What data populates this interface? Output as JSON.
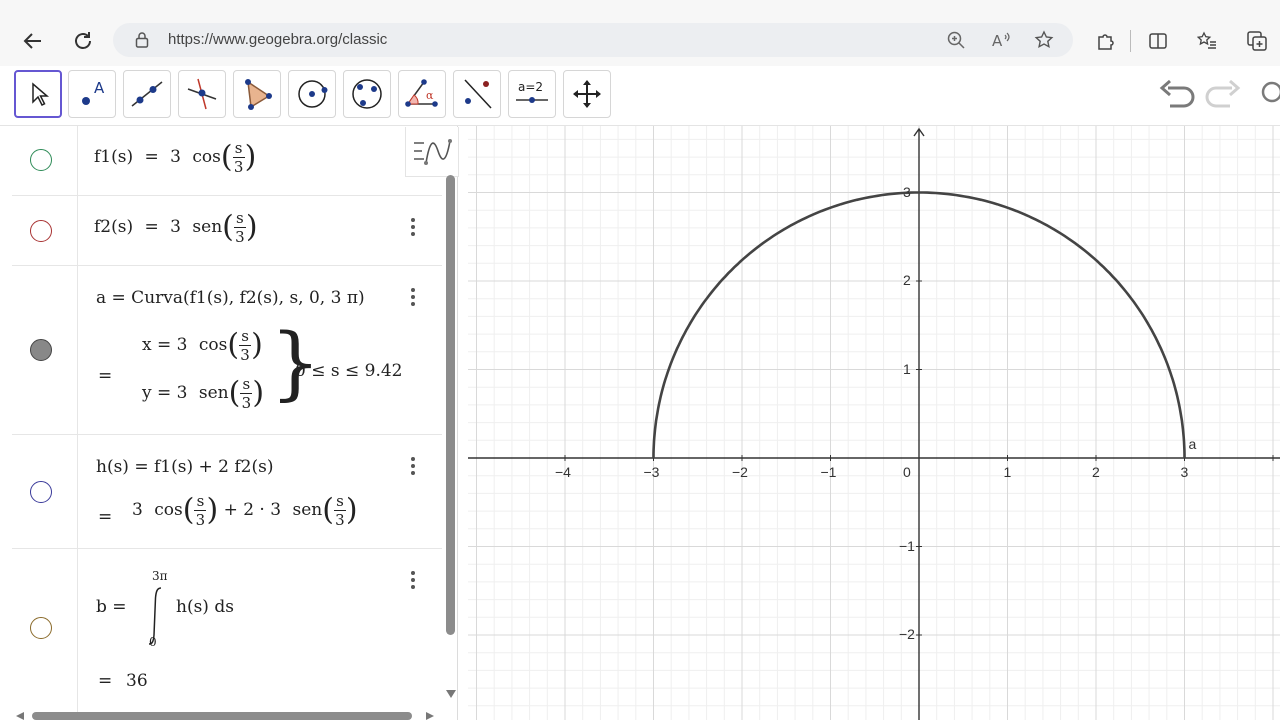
{
  "browser": {
    "url": "https://www.geogebra.org/classic"
  },
  "toolbar": {
    "tools": [
      {
        "id": "move",
        "icon": "arrow-pointer-icon"
      },
      {
        "id": "point",
        "icon": "point-icon",
        "label": "A"
      },
      {
        "id": "line",
        "icon": "line-icon"
      },
      {
        "id": "perpendicular",
        "icon": "perpendicular-line-icon"
      },
      {
        "id": "polygon",
        "icon": "polygon-icon"
      },
      {
        "id": "circle",
        "icon": "circle-center-point-icon"
      },
      {
        "id": "circle3",
        "icon": "circle-three-points-icon"
      },
      {
        "id": "angle",
        "icon": "angle-icon",
        "label": "α"
      },
      {
        "id": "reflect",
        "icon": "reflect-line-icon"
      },
      {
        "id": "slider",
        "icon": "slider-icon",
        "label": "a=2"
      },
      {
        "id": "move-view",
        "icon": "move-graphics-icon"
      }
    ]
  },
  "algebra": {
    "f1": {
      "name": "f1(s)",
      "eq": "=",
      "coef": "3",
      "fn": "cos",
      "num": "s",
      "den": "3"
    },
    "f2": {
      "name": "f2(s)",
      "eq": "=",
      "coef": "3",
      "fn": "sen",
      "num": "s",
      "den": "3"
    },
    "curve": {
      "def": "a = Curva(f1(s), f2(s), s, 0, 3 π)",
      "eq": "=",
      "x_line": {
        "lhs": "x = 3",
        "fn": "cos",
        "num": "s",
        "den": "3"
      },
      "y_line": {
        "lhs": "y = 3",
        "fn": "sen",
        "num": "s",
        "den": "3"
      },
      "range": "0 ≤ s ≤ 9.42"
    },
    "h": {
      "def": "h(s) = f1(s) + 2 f2(s)",
      "eq": "=",
      "t1_coef": "3",
      "t1_fn": "cos",
      "t1_num": "s",
      "t1_den": "3",
      "mid": "+ 2 · 3",
      "t2_fn": "sen",
      "t2_num": "s",
      "t2_den": "3"
    },
    "b": {
      "lhs": "b =",
      "upper": "3π",
      "lower": "0",
      "integrand": "h(s) ds",
      "eq": "=",
      "value": "36"
    }
  },
  "graph": {
    "x_ticks": [
      "−4",
      "−3",
      "−2",
      "−1",
      "0",
      "1",
      "2",
      "3"
    ],
    "y_ticks": [
      "3",
      "2",
      "1",
      "−1",
      "−2"
    ],
    "curve_label": "a",
    "curve_radius": 3,
    "curve_range": [
      0,
      3.14159
    ],
    "colors": {
      "curve": "#444444",
      "grid_major": "#d9d9d9",
      "grid_minor": "#efefef",
      "axis": "#333333"
    }
  }
}
